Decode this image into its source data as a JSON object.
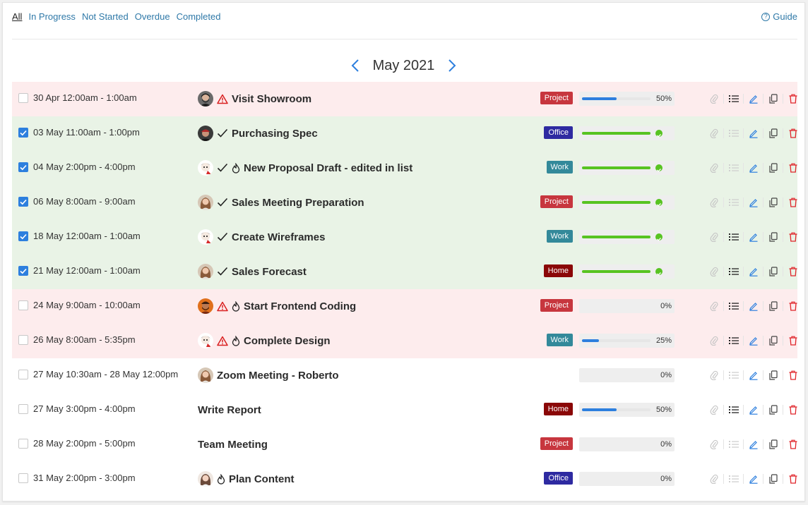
{
  "filters": {
    "items": [
      "All",
      "In Progress",
      "Not Started",
      "Overdue",
      "Completed"
    ],
    "active": "All",
    "guide": "Guide"
  },
  "month": {
    "label": "May 2021"
  },
  "colors": {
    "Project": "#c7363e",
    "Office": "#2e2aa1",
    "Work": "#33899a",
    "Home": "#8a0707"
  },
  "tasks": [
    {
      "date": "30 Apr 12:00am - 1:00am",
      "title": "Visit Showroom",
      "status": "overdue",
      "checked": false,
      "avatar": "dark-beard",
      "warn": true,
      "drop": false,
      "done": false,
      "tag": "Project",
      "progress": 50,
      "progress_label": "50%",
      "list": true
    },
    {
      "date": "03 May 11:00am - 1:00pm",
      "title": "Purchasing Spec",
      "status": "done",
      "checked": true,
      "avatar": "man-cap",
      "warn": false,
      "drop": false,
      "done": true,
      "tag": "Office",
      "progress": 100,
      "progress_label": "",
      "list": false
    },
    {
      "date": "04 May 2:00pm - 4:00pm",
      "title": "New Proposal Draft - edited in list",
      "status": "done",
      "checked": true,
      "avatar": "cartoon",
      "warn": false,
      "drop": true,
      "done": true,
      "tag": "Work",
      "progress": 100,
      "progress_label": "",
      "list": false
    },
    {
      "date": "06 May 8:00am - 9:00am",
      "title": "Sales Meeting Preparation",
      "status": "done",
      "checked": true,
      "avatar": "woman",
      "warn": false,
      "drop": false,
      "done": true,
      "tag": "Project",
      "progress": 100,
      "progress_label": "",
      "list": false
    },
    {
      "date": "18 May 12:00am - 1:00am",
      "title": "Create Wireframes",
      "status": "done",
      "checked": true,
      "avatar": "cartoon",
      "warn": false,
      "drop": false,
      "done": true,
      "tag": "Work",
      "progress": 100,
      "progress_label": "",
      "list": true
    },
    {
      "date": "21 May 12:00am - 1:00am",
      "title": "Sales Forecast",
      "status": "done",
      "checked": true,
      "avatar": "woman",
      "warn": false,
      "drop": false,
      "done": true,
      "tag": "Home",
      "progress": 100,
      "progress_label": "",
      "list": true
    },
    {
      "date": "24 May 9:00am - 10:00am",
      "title": "Start Frontend Coding",
      "status": "overdue",
      "checked": false,
      "avatar": "orange-man",
      "warn": true,
      "drop": true,
      "done": false,
      "tag": "Project",
      "progress": 0,
      "progress_label": "0%",
      "list": true
    },
    {
      "date": "26 May 8:00am - 5:35pm",
      "title": "Complete Design",
      "status": "overdue",
      "checked": false,
      "avatar": "cartoon",
      "warn": true,
      "drop": true,
      "done": false,
      "tag": "Work",
      "progress": 25,
      "progress_label": "25%",
      "list": true
    },
    {
      "date": "27 May 10:30am - 28 May 12:00pm",
      "title": "Zoom Meeting - Roberto",
      "status": "normal",
      "checked": false,
      "avatar": "woman",
      "warn": false,
      "drop": false,
      "done": false,
      "tag": "",
      "progress": 0,
      "progress_label": "0%",
      "list": false
    },
    {
      "date": "27 May 3:00pm - 4:00pm",
      "title": "Write Report",
      "status": "normal",
      "checked": false,
      "avatar": "",
      "warn": false,
      "drop": false,
      "done": false,
      "tag": "Home",
      "progress": 50,
      "progress_label": "50%",
      "list": true
    },
    {
      "date": "28 May 2:00pm - 5:00pm",
      "title": "Team Meeting",
      "status": "normal",
      "checked": false,
      "avatar": "",
      "warn": false,
      "drop": false,
      "done": false,
      "tag": "Project",
      "progress": 0,
      "progress_label": "0%",
      "list": false
    },
    {
      "date": "31 May 2:00pm - 3:00pm",
      "title": "Plan Content",
      "status": "normal",
      "checked": false,
      "avatar": "woman-light",
      "warn": false,
      "drop": true,
      "done": false,
      "tag": "Office",
      "progress": 0,
      "progress_label": "0%",
      "list": false
    }
  ]
}
